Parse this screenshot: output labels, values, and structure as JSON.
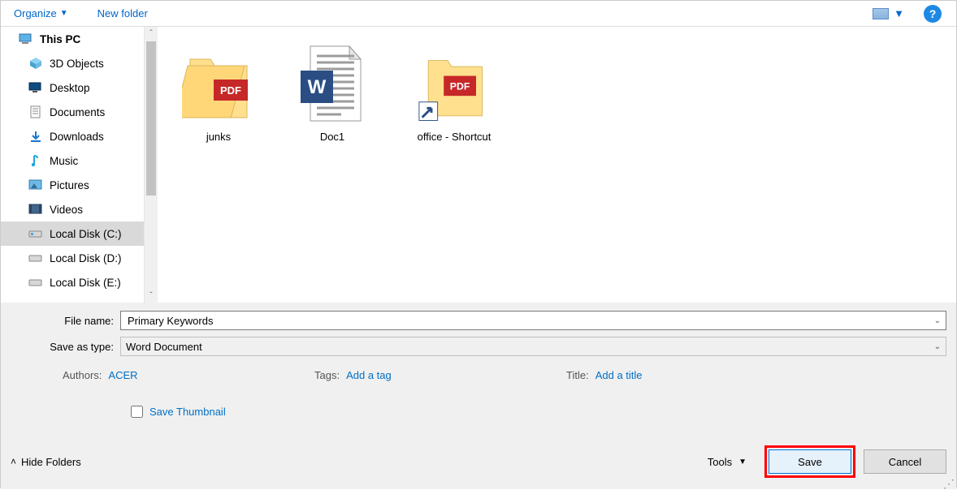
{
  "toolbar": {
    "organize_label": "Organize",
    "new_folder_label": "New folder"
  },
  "sidebar": {
    "items": [
      {
        "label": "This PC",
        "root": true
      },
      {
        "label": "3D Objects"
      },
      {
        "label": "Desktop"
      },
      {
        "label": "Documents"
      },
      {
        "label": "Downloads"
      },
      {
        "label": "Music"
      },
      {
        "label": "Pictures"
      },
      {
        "label": "Videos"
      },
      {
        "label": "Local Disk (C:)",
        "selected": true
      },
      {
        "label": "Local Disk (D:)"
      },
      {
        "label": "Local Disk (E:)"
      }
    ]
  },
  "files": [
    {
      "label": "junks"
    },
    {
      "label": "Doc1"
    },
    {
      "label": "office - Shortcut"
    }
  ],
  "form": {
    "file_name_label": "File name:",
    "file_name_value": "Primary Keywords",
    "save_as_type_label": "Save as type:",
    "save_as_type_value": "Word Document"
  },
  "meta": {
    "authors_label": "Authors:",
    "authors_value": "ACER",
    "tags_label": "Tags:",
    "tags_value": "Add a tag",
    "title_label": "Title:",
    "title_value": "Add a title",
    "save_thumbnail_label": "Save Thumbnail"
  },
  "footer": {
    "hide_folders_label": "Hide Folders",
    "tools_label": "Tools",
    "save_label": "Save",
    "cancel_label": "Cancel"
  }
}
